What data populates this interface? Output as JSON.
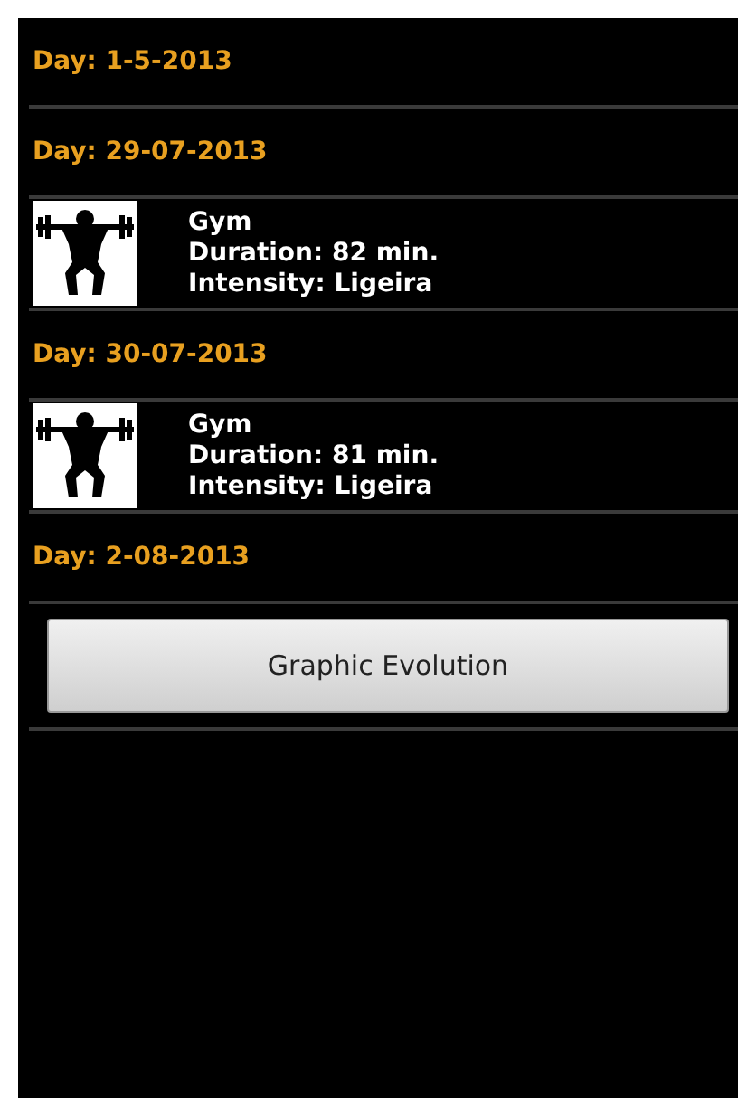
{
  "days": [
    {
      "label": "Day: 1-5-2013"
    },
    {
      "label": "Day: 29-07-2013",
      "workouts": [
        {
          "name": "Gym",
          "duration": "Duration: 82 min.",
          "intensity": "Intensity: Ligeira"
        }
      ]
    },
    {
      "label": "Day: 30-07-2013",
      "workouts": [
        {
          "name": "Gym",
          "duration": "Duration: 81 min.",
          "intensity": "Intensity: Ligeira"
        }
      ]
    },
    {
      "label": "Day: 2-08-2013"
    }
  ],
  "button": "Graphic Evolution"
}
